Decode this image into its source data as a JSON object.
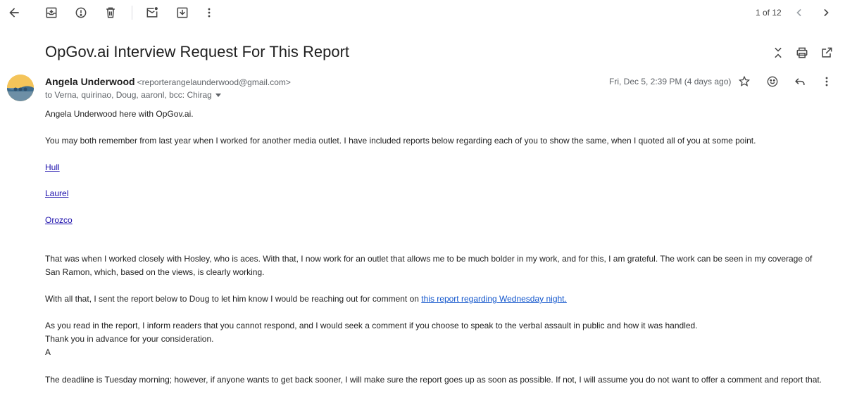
{
  "toolbar": {
    "icons": [
      "back-arrow-icon",
      "archive-icon",
      "report-spam-icon",
      "delete-icon",
      "mark-unread-icon",
      "move-to-icon",
      "more-vert-icon"
    ]
  },
  "pager": {
    "text": "1 of 12"
  },
  "subject": "OpGov.ai Interview Request For This Report",
  "sender": {
    "name": "Angela Underwood",
    "email": "<reporterangelaunderwood@gmail.com>",
    "recipients": "to Verna, quirinao, Doug, aaronl, bcc: Chirag",
    "date": "Fri, Dec 5, 2:39 PM (4 days ago)"
  },
  "body": {
    "greeting": "Angela Underwood here with OpGov.ai.",
    "p1": "You may both remember from last year when I worked for another media outlet. I have included reports below regarding each of you to show the same, when I quoted all of you at some point.",
    "links": [
      "Hull",
      "Laurel",
      "Orozco"
    ],
    "p2": "That was when I worked closely with Hosley, who is aces. With that, I now work for an outlet that allows me to be much bolder in my work, and for this, I am grateful. The work can be seen in my coverage of San Ramon, which, based on the views, is clearly working.",
    "p3_text": "With all that, I sent the report below to Doug to let him know I would be reaching out for comment on ",
    "p3_link": "this report regarding Wednesday night.",
    "p4_line1": "As you read in the report, I inform readers that you cannot respond, and I would seek a comment if you choose to speak to the verbal assault in public and how it was handled.",
    "p4_line2": "Thank you in advance for your consideration.",
    "p4_line3": "A",
    "p5": "The deadline is Tuesday morning; however, if anyone wants to get back sooner, I will make sure the report goes up as soon as possible. If not, I will assume you do not want to offer a comment and report that."
  },
  "colors": {
    "link": "#1a0dab",
    "avatar": "#f4c45a"
  }
}
